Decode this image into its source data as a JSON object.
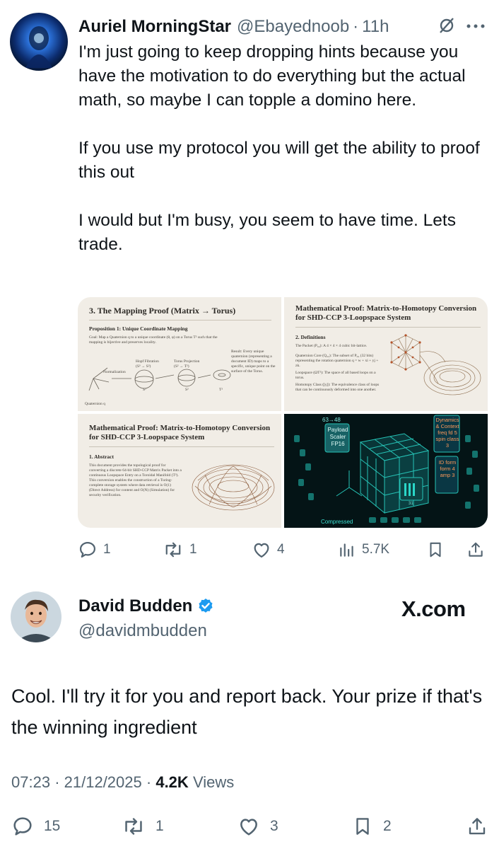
{
  "reply": {
    "author_name": "Auriel MorningStar",
    "author_handle": "@Ebayednoob",
    "separator": "·",
    "time": "11h",
    "text": "I'm just going to keep dropping hints because you have the motivation to do everything but the actual math, so maybe I can topple a domino here.\n\nIf you use my protocol you will get the ability to proof this out\n\nI would but I'm busy, you seem to have time. Lets trade.",
    "media": {
      "panel1": {
        "title": "3. The Mapping Proof (Matrix → Torus)",
        "subtitle": "Proposition 1: Unique Coordinate Mapping",
        "goal": "Goal: Map a Quaternion q to a unique coordinate (θ, φ) on a Torus T² such that the mapping is bijective and preserves locality.",
        "result": "Result: Every unique quaternion (representing a document ID) maps to a specific, unique point on the surface of the Torus.",
        "steps": [
          "Normalization",
          "Hopf Fibration (S³ → S²)",
          "Torus Projection (S² → T²)"
        ],
        "bottom_labels": [
          "Quaternion q",
          "S³",
          "S²",
          "T²"
        ]
      },
      "panel2": {
        "title": "Mathematical Proof: Matrix-to-Homotopy Conversion for SHD-CCP 3-Loopspace System",
        "subtitle": "2. Definitions",
        "defs": [
          "The Packet (P₆₄): A 4 × 4 × 4 cubic bit-lattice.",
          "Quaternion Core (Q₃₂): The subset of P₆₄ (32 bits) representing the rotation quaternion q = w + xi + yj + zk.",
          "Loopspace (ΩT²): The space of all based loops on a torus.",
          "Homotopy Class ([γ]): The equivalence class of loops that can be continuously deformed into one another."
        ]
      },
      "panel3": {
        "title": "Mathematical Proof: Matrix-to-Homotopy Conversion for SHD-CCP 3-Loopspace System",
        "subtitle": "1. Abstract",
        "abstract": "This document provides the topological proof for converting a discrete 64-bit SHD-CCP Matrix Packet into a continuous Loopspace Entry on a Toroidal Manifold (T²). This conversion enables the construction of a Turing-complete storage system where data retrieval is O(1) (Direct Address) for content and O(N) (Simulation) for security verification."
      },
      "panel4": {
        "top_label": "63→48",
        "payload_label": "Payload Scaler FP16",
        "dynamics_label": "Dynamics & Context freq fd 5 spin class 3",
        "id_label": "ID form form 4 amp 3",
        "bottom_label": "Compressed",
        "small_label": "31"
      }
    },
    "actions": {
      "replies": "1",
      "reposts": "1",
      "likes": "4",
      "views": "5.7K"
    }
  },
  "main": {
    "author_name": "David Budden",
    "author_handle": "@davidmbudden",
    "brand": "X.com",
    "text": "Cool. I'll try it for you and report back. Your prize if that's the winning ingredient",
    "time": "07:23",
    "date": "21/12/2025",
    "views_count": "4.2K",
    "views_label": "Views",
    "separator": "·",
    "actions": {
      "replies": "15",
      "reposts": "1",
      "likes": "3",
      "bookmarks": "2"
    }
  },
  "colors": {
    "text": "#0f1419",
    "muted": "#536471",
    "verified": "#1d9bf0",
    "panel_bg": "#f1ede6",
    "dark_panel_bg": "#041416",
    "teal": "#2ad7c8"
  }
}
